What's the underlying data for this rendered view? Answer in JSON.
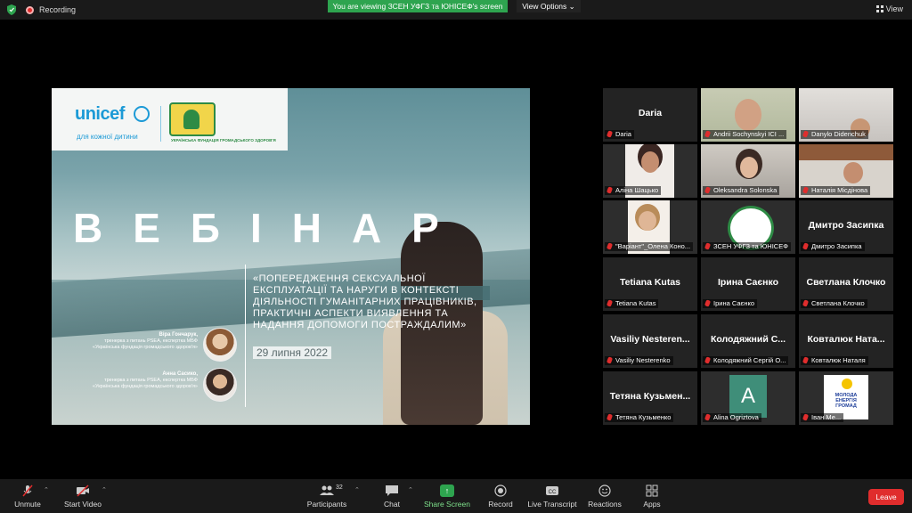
{
  "topbar": {
    "recording_label": "Recording",
    "viewing_banner": "You are viewing ЗСЕН УФГЗ та ЮНІСЕФ's screen",
    "view_options": "View Options",
    "view_label": "View"
  },
  "slide": {
    "unicef_logo": "unicef",
    "unicef_tagline": "для кожної дитини",
    "fund_logo_text": "УКРАЇНСЬКА ФУНДАЦІЯ ГРОМАДСЬКОГО ЗДОРОВ'Я",
    "heading": "ВЕБІНАР",
    "topic": "«Попередження сексуальної експлуатації та наруги в контексті діяльності гуманітарних працівників, практичні аспекти виявлення та надання допомоги постраждалим»",
    "date": "29 липня 2022",
    "speakers": [
      {
        "name": "Віра Гончарук,",
        "role": "тренерка з питань PSEA, експертка МБФ «Українська фундація громадського здоров'я»"
      },
      {
        "name": "Анна Сасико,",
        "role": "тренерка з питань PSEA, експертка МБФ «Українська фундація громадського здоров'я»"
      }
    ]
  },
  "participants": [
    {
      "big": "Daria",
      "caption": "Daria"
    },
    {
      "big": "",
      "caption": "Andrii Sochynskyi ICI ..."
    },
    {
      "big": "",
      "caption": "Danylo Didenchuk"
    },
    {
      "big": "",
      "caption": "Аліна Шацько"
    },
    {
      "big": "",
      "caption": "Oleksandra Solonska"
    },
    {
      "big": "",
      "caption": "Наталія Місдінова"
    },
    {
      "big": "",
      "caption": "\"Варіант\"_Олена Коно..."
    },
    {
      "big": "",
      "caption": "ЗСЕН УФГЗ та ЮНІСЕФ"
    },
    {
      "big": "Дмитро Засипка",
      "caption": "Дмитро Засипка"
    },
    {
      "big": "Tetiana Kutas",
      "caption": "Tetiana Kutas"
    },
    {
      "big": "Ірина Саєнко",
      "caption": "Ірина Саєнко"
    },
    {
      "big": "Светлана Клочко",
      "caption": "Светлана Клочко"
    },
    {
      "big": "Vasiliy Nesteren...",
      "caption": "Vasiliy Nesterenko"
    },
    {
      "big": "Колодяжний С...",
      "caption": "Колодяжний Сергій О..."
    },
    {
      "big": "Ковталюк Ната...",
      "caption": "Ковталюк Наталя"
    },
    {
      "big": "Тетяна Кузьмен...",
      "caption": "Тетяна Кузьменко"
    },
    {
      "big": "",
      "caption": "Alina Ogriztova",
      "letter": "A"
    },
    {
      "big": "",
      "caption": "Іван Ме...",
      "org_text": "МОЛОДА ЕНЕРГІЯ ГРОМАД"
    }
  ],
  "toolbar": {
    "unmute": "Unmute",
    "start_video": "Start Video",
    "participants": "Participants",
    "participants_count": "32",
    "chat": "Chat",
    "share_screen": "Share Screen",
    "record": "Record",
    "live_transcript": "Live Transcript",
    "reactions": "Reactions",
    "apps": "Apps",
    "leave": "Leave"
  }
}
